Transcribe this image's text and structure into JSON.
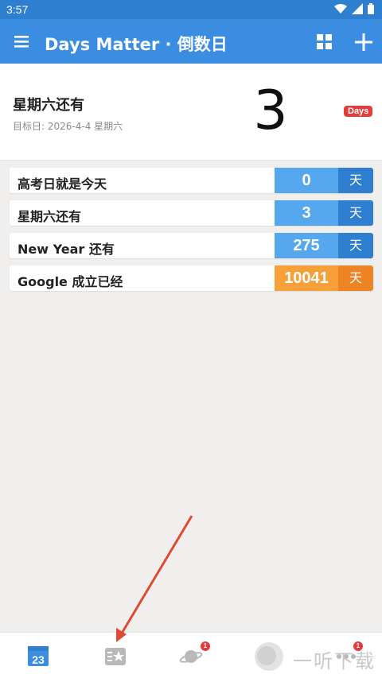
{
  "status": {
    "time": "3:57",
    "icons": [
      "wifi-icon",
      "signal-icon",
      "battery-icon"
    ]
  },
  "appbar": {
    "title": "Days Matter · 倒数日",
    "icons": [
      "menu-icon",
      "grid-icon",
      "plus-icon"
    ]
  },
  "hero": {
    "title": "星期六还有",
    "subtitle": "目标日: 2026-4-4 星期六",
    "number": "3",
    "badge": "Days"
  },
  "events": [
    {
      "label": "高考日就是今天",
      "value": "0",
      "unit": "天",
      "color": "blue"
    },
    {
      "label": "星期六还有",
      "value": "3",
      "unit": "天",
      "color": "blue"
    },
    {
      "label": "New Year 还有",
      "value": "275",
      "unit": "天",
      "color": "blue"
    },
    {
      "label": "Google 成立已经",
      "value": "10041",
      "unit": "天",
      "color": "orange"
    }
  ],
  "bottom_nav": {
    "calendar_date": "23",
    "badges": {
      "discover": "1",
      "more": "1"
    }
  },
  "watermark": "一听下载",
  "colors": {
    "primary": "#3a8de0",
    "accent_orange": "#f7a03a",
    "badge_red": "#e63b3b",
    "arrow": "#e04a32"
  }
}
